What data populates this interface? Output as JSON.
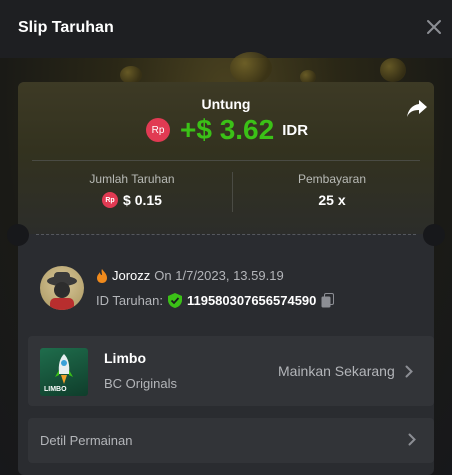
{
  "header": {
    "title": "Slip Taruhan"
  },
  "profit": {
    "label": "Untung",
    "badge": "Rp",
    "value": "+$ 3.62",
    "currency": "IDR"
  },
  "stats": {
    "bet_label": "Jumlah Taruhan",
    "bet_badge": "Rp",
    "bet_value": "$ 0.15",
    "payout_label": "Pembayaran",
    "payout_value": "25 x"
  },
  "user": {
    "name": "Jorozz",
    "date": "On 1/7/2023, 13.59.19",
    "id_label": "ID Taruhan:",
    "id_value": "119580307656574590"
  },
  "game": {
    "thumb_text": "LIMBO",
    "name": "Limbo",
    "provider": "BC Originals",
    "play_label": "Mainkan Sekarang"
  },
  "detail": {
    "label": "Detil Permainan"
  },
  "colors": {
    "accent_green": "#3bc117",
    "badge_red": "#e13a53",
    "background": "#17181b",
    "card": "#2a2c30"
  }
}
